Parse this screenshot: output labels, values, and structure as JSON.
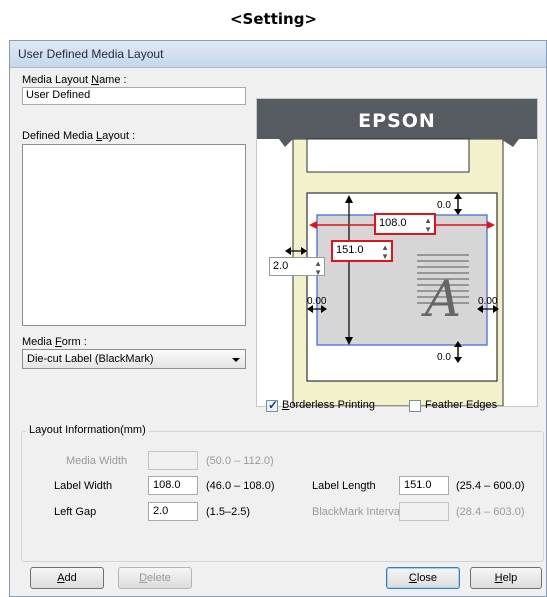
{
  "heading": "<Setting>",
  "dialog": {
    "title": "User Defined Media Layout",
    "media_layout_name": {
      "label_pre": "Media Layout ",
      "label_accel": "N",
      "label_post": "ame :",
      "value": "User Defined"
    },
    "defined_media_layout": {
      "label_pre": "Defined Media ",
      "label_accel": "L",
      "label_post": "ayout :"
    },
    "media_form": {
      "label_pre": "Media ",
      "label_accel": "F",
      "label_post": "orm :",
      "value": "Die-cut Label (BlackMark)"
    },
    "preview": {
      "brand": "EPSON",
      "label_length_value": "108.0",
      "label_width_value": "151.0",
      "left_gap_value": "2.0",
      "top_margin": "0.0",
      "bottom_margin": "0.0",
      "left_margin": "0.00",
      "right_margin": "0.00",
      "glyph": "A"
    },
    "borderless_printing": {
      "label_accel": "B",
      "label_rest": "orderless Printing",
      "checked": true
    },
    "feather_edges": {
      "label": "Feather Edges",
      "checked": false
    },
    "layout_info": {
      "title": "Layout Information(mm)",
      "media_width": {
        "label": "Media Width",
        "value": "",
        "range": "(50.0 – 112.0)"
      },
      "label_width": {
        "label": "Label Width",
        "value": "108.0",
        "range": "(46.0 – 108.0)"
      },
      "left_gap": {
        "label": "Left Gap",
        "value": "2.0",
        "range": "(1.5–2.5)"
      },
      "label_length": {
        "label": "Label Length",
        "value": "151.0",
        "range": "(25.4 – 600.0)"
      },
      "blackmark_interval": {
        "label": "BlackMark Interval",
        "value": "",
        "range": "(28.4 – 603.0)"
      }
    },
    "buttons": {
      "add": {
        "accel": "A",
        "rest": "dd"
      },
      "delete": {
        "accel": "D",
        "rest": "elete"
      },
      "close": {
        "accel": "C",
        "rest": "lose"
      },
      "help": {
        "accel": "H",
        "rest": "elp"
      }
    }
  }
}
